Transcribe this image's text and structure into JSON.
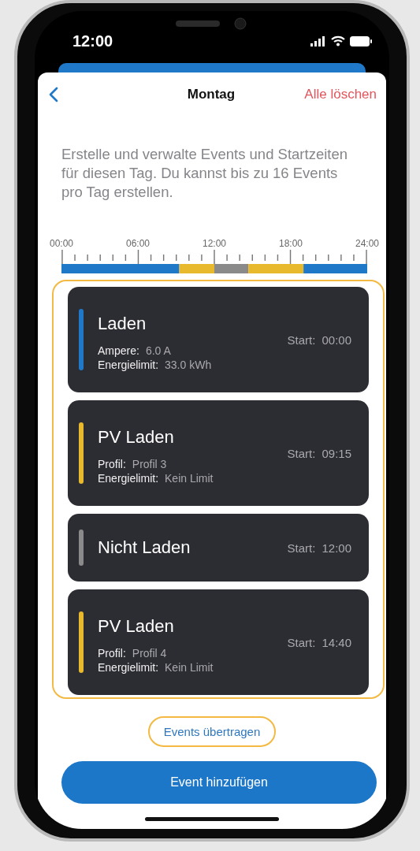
{
  "status_bar": {
    "time": "12:00"
  },
  "nav": {
    "title": "Montag",
    "action": "Alle löschen"
  },
  "description": "Erstelle und verwalte Events und Startzeiten für diesen Tag. Du kannst bis zu 16 Events pro Tag erstellen.",
  "timeline": {
    "chart_data": {
      "type": "bar",
      "orientation": "horizontal",
      "stacked": true,
      "xlim": [
        0,
        24
      ],
      "xticks": [
        {
          "value": 0,
          "label": "00:00"
        },
        {
          "value": 6,
          "label": "06:00"
        },
        {
          "value": 12,
          "label": "12:00"
        },
        {
          "value": 18,
          "label": "18:00"
        },
        {
          "value": 24,
          "label": "24:00"
        }
      ],
      "series": [
        {
          "color": "#1f78c8",
          "values": [
            9.25
          ]
        },
        {
          "color": "#e8b92c",
          "values": [
            2.75
          ]
        },
        {
          "color": "#8a8a8a",
          "values": [
            2.67
          ]
        },
        {
          "color": "#e8b92c",
          "values": [
            4.33
          ]
        },
        {
          "color": "#1f78c8",
          "values": [
            5
          ]
        }
      ]
    }
  },
  "events": [
    {
      "title": "Laden",
      "color": "#1f78c8",
      "start_label": "Start:",
      "start": "00:00",
      "details": [
        {
          "label": "Ampere:",
          "value": "6.0 A"
        },
        {
          "label": "Energielimit:",
          "value": "33.0 kWh"
        }
      ]
    },
    {
      "title": "PV Laden",
      "color": "#e8b92c",
      "start_label": "Start:",
      "start": "09:15",
      "details": [
        {
          "label": "Profil:",
          "value": "Profil 3"
        },
        {
          "label": "Energielimit:",
          "value": "Kein Limit"
        }
      ]
    },
    {
      "title": "Nicht Laden",
      "color": "#8a8a8a",
      "start_label": "Start:",
      "start": "12:00"
    },
    {
      "title": "PV Laden",
      "color": "#e8b92c",
      "start_label": "Start:",
      "start": "14:40",
      "details": [
        {
          "label": "Profil:",
          "value": "Profil 4"
        },
        {
          "label": "Energielimit:",
          "value": "Kein Limit"
        }
      ]
    }
  ],
  "transfer_link": "Events übertragen",
  "add_button": "Event hinzufügen"
}
